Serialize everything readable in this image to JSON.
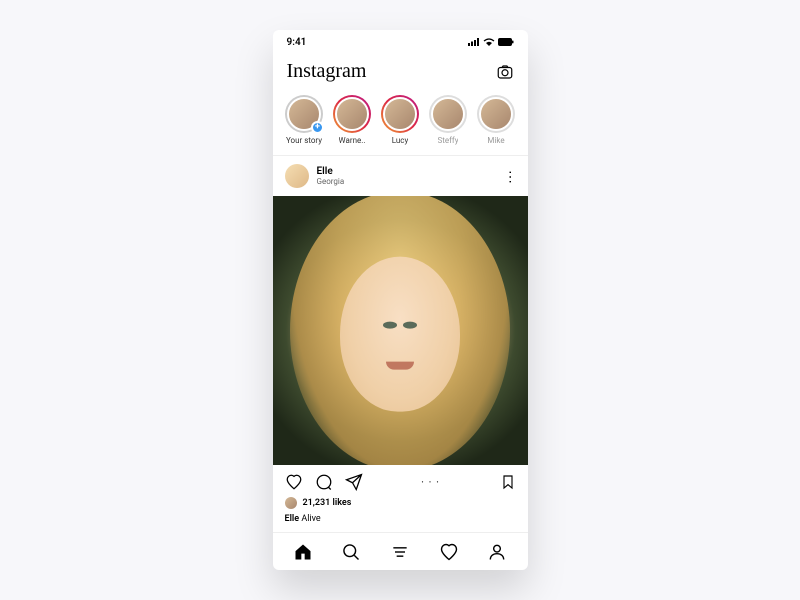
{
  "status": {
    "time": "9:41"
  },
  "header": {
    "logo": "Instagram"
  },
  "stories": [
    {
      "label": "Your story",
      "ring": "none",
      "add": true,
      "muted": false
    },
    {
      "label": "Warne..",
      "ring": "gradient",
      "add": false,
      "muted": false
    },
    {
      "label": "Lucy",
      "ring": "gradient",
      "add": false,
      "muted": false
    },
    {
      "label": "Steffy",
      "ring": "gray",
      "add": false,
      "muted": true
    },
    {
      "label": "Mike",
      "ring": "gray",
      "add": false,
      "muted": true
    }
  ],
  "post": {
    "user": "Elle",
    "location": "Georgia",
    "likes": "21,231 likes",
    "caption_user": "Elle",
    "caption_text": "Alive"
  },
  "colors": {
    "accent": "#3897f0"
  }
}
